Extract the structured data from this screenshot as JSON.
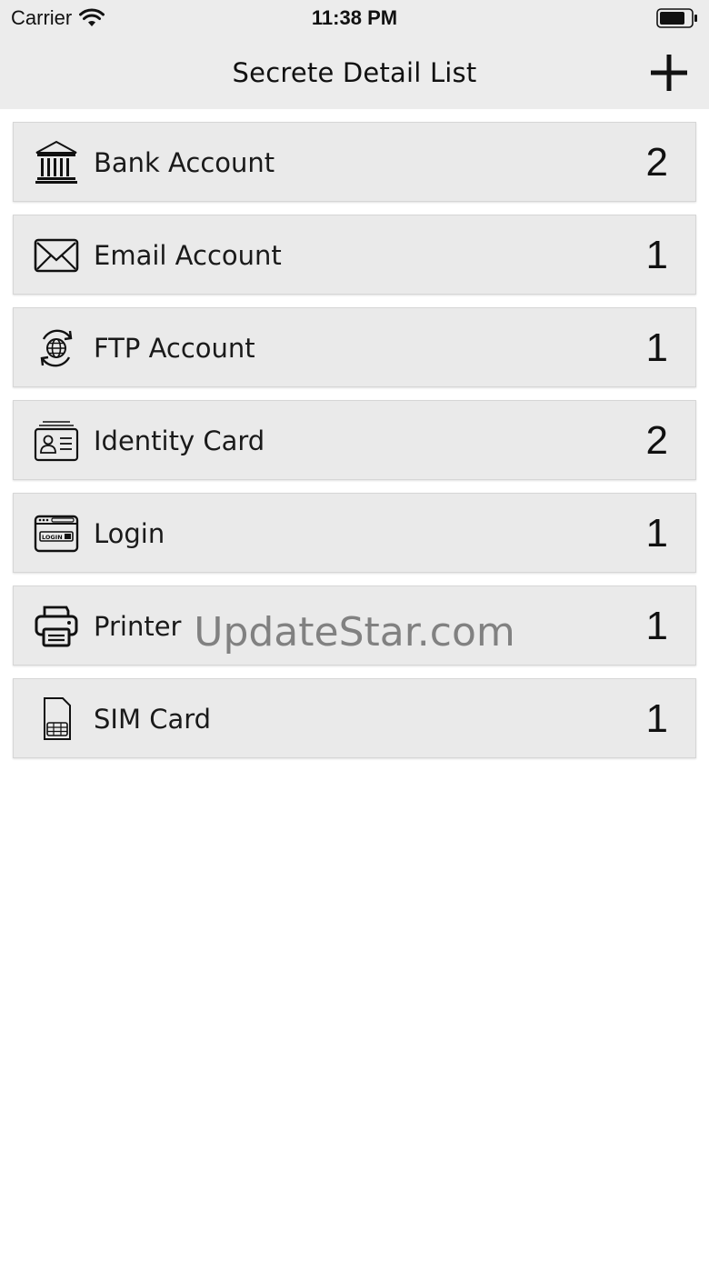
{
  "status_bar": {
    "carrier": "Carrier",
    "time": "11:38 PM",
    "wifi_icon": "wifi-icon",
    "battery_icon": "battery-icon"
  },
  "nav": {
    "title": "Secrete Detail List",
    "add_icon": "plus-icon"
  },
  "items": [
    {
      "label": "Bank Account",
      "count": "2",
      "icon": "bank-icon"
    },
    {
      "label": "Email Account",
      "count": "1",
      "icon": "envelope-icon"
    },
    {
      "label": "FTP Account",
      "count": "1",
      "icon": "globe-sync-icon"
    },
    {
      "label": "Identity Card",
      "count": "2",
      "icon": "id-card-icon"
    },
    {
      "label": "Login",
      "count": "1",
      "icon": "login-window-icon"
    },
    {
      "label": "Printer",
      "count": "1",
      "icon": "printer-icon"
    },
    {
      "label": "SIM Card",
      "count": "1",
      "icon": "sim-card-icon"
    }
  ],
  "watermark": "UpdateStar.com",
  "colors": {
    "bar_background": "#ececec",
    "row_background": "#eaeaea",
    "text": "#111111"
  }
}
